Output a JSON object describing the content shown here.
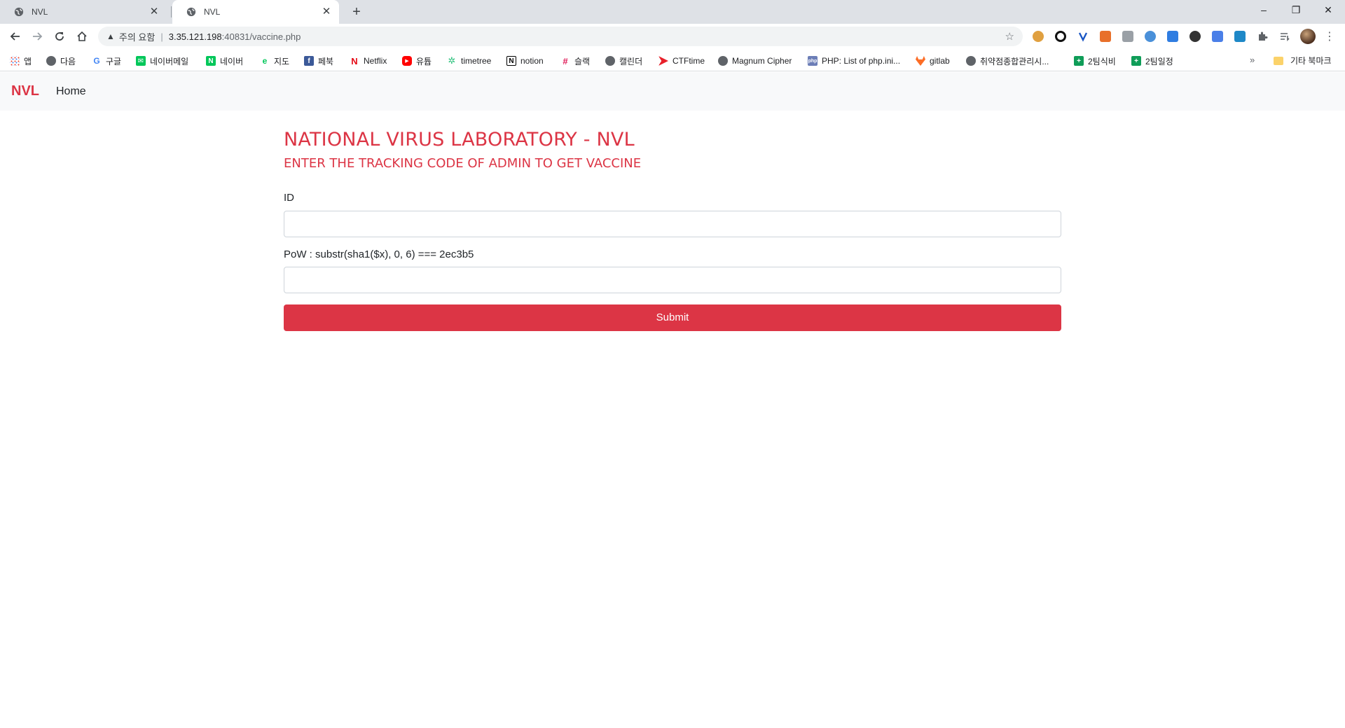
{
  "browser": {
    "tabs": [
      {
        "title": "NVL",
        "active": false
      },
      {
        "title": "NVL",
        "active": true
      }
    ],
    "new_tab": "+",
    "window_controls": {
      "minimize": "–",
      "restore": "❐",
      "close": "✕"
    },
    "address": {
      "warning_icon": "warning-triangle-icon",
      "warning_text": "주의 요함",
      "separator": "|",
      "host": "3.35.121.198",
      "path": ":40831/vaccine.php"
    },
    "bookmarks": [
      {
        "label": "앱",
        "icon": "apps-grid-icon"
      },
      {
        "label": "다음",
        "icon": "globe-icon"
      },
      {
        "label": "구글",
        "icon": "google-icon"
      },
      {
        "label": "네이버메일",
        "icon": "naver-mail-icon"
      },
      {
        "label": "네이버",
        "icon": "naver-icon"
      },
      {
        "label": "지도",
        "icon": "map-icon"
      },
      {
        "label": "페북",
        "icon": "facebook-icon"
      },
      {
        "label": "Netflix",
        "icon": "netflix-icon"
      },
      {
        "label": "유튭",
        "icon": "youtube-icon"
      },
      {
        "label": "timetree",
        "icon": "timetree-icon"
      },
      {
        "label": "notion",
        "icon": "notion-icon"
      },
      {
        "label": "슬랙",
        "icon": "slack-icon"
      },
      {
        "label": "캘린더",
        "icon": "globe-icon"
      },
      {
        "label": "CTFtime",
        "icon": "ctftime-icon"
      },
      {
        "label": "Magnum Cipher",
        "icon": "globe-icon"
      },
      {
        "label": "PHP: List of php.ini...",
        "icon": "php-icon"
      },
      {
        "label": "gitlab",
        "icon": "gitlab-icon"
      },
      {
        "label": "취약점종합관리시...",
        "icon": "globe-icon"
      },
      {
        "label": "2팀식비",
        "icon": "sheets-icon"
      },
      {
        "label": "2팀일정",
        "icon": "sheets-icon"
      }
    ],
    "bookmarks_more": "»",
    "other_bookmarks": "기타 북마크"
  },
  "site": {
    "brand": "NVL",
    "nav": {
      "home": "Home"
    },
    "title": "NATIONAL VIRUS LABORATORY - NVL",
    "subtitle": "ENTER THE TRACKING CODE OF ADMIN TO GET VACCINE",
    "form": {
      "id_label": "ID",
      "id_value": "",
      "pow_label": "PoW : substr(sha1($x), 0, 6) === 2ec3b5",
      "pow_value": "",
      "submit_label": "Submit"
    }
  },
  "colors": {
    "accent": "#dc3545",
    "navbar_bg": "#f8f9fa",
    "tabstrip_bg": "#dee1e6"
  }
}
